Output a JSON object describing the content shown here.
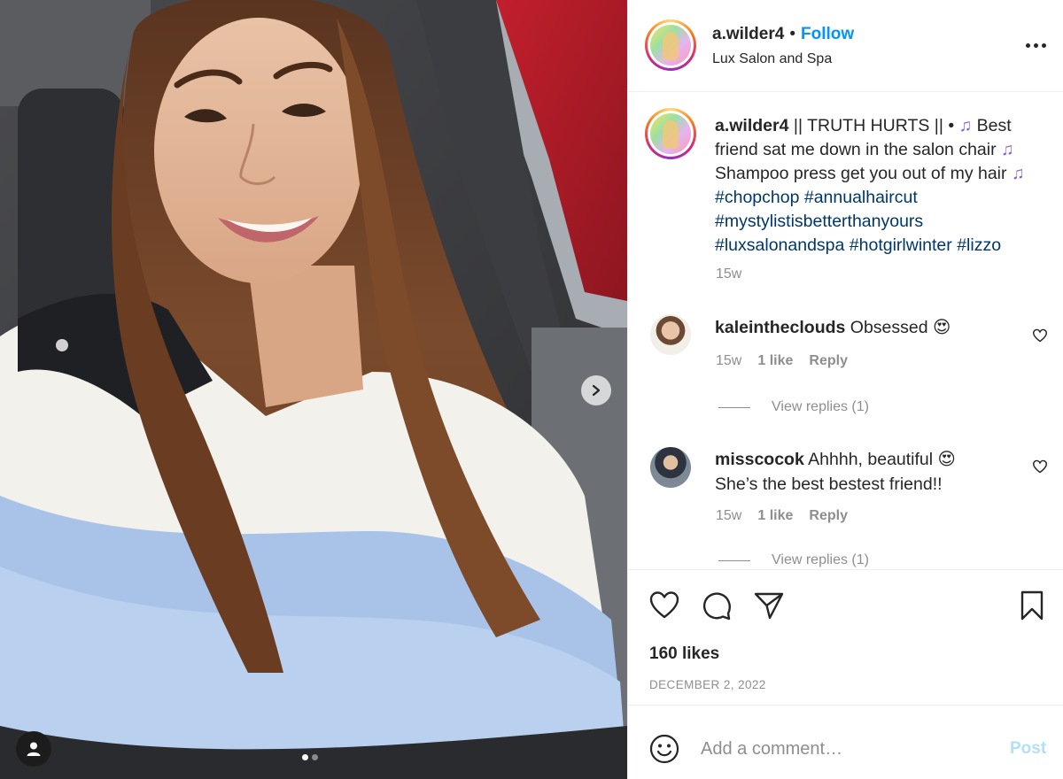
{
  "post": {
    "username": "a.wilder4",
    "separator": "•",
    "follow_label": "Follow",
    "location": "Lux Salon and Spa",
    "caption": {
      "username": "a.wilder4",
      "text_1": " || TRUTH HURTS || • ",
      "text_2": " Best friend sat me down in the salon chair ",
      "text_3": " Shampoo press get you out of my hair ",
      "hashtags": [
        "#chopchop",
        "#annualhaircut",
        "#mystylistisbetterthanyours",
        "#luxsalonandspa",
        "#hotgirlwinter",
        "#lizzo"
      ],
      "time": "15w"
    },
    "comments": [
      {
        "username": "kaleintheclouds",
        "text": "Obsessed",
        "time": "15w",
        "likes": "1 like",
        "reply_label": "Reply",
        "view_replies": "View replies (1)"
      },
      {
        "username": "misscocok",
        "text": "Ahhhh, beautiful",
        "text_line2": "She’s the best bestest friend!!",
        "time": "15w",
        "likes": "1 like",
        "reply_label": "Reply",
        "view_replies": "View replies (1)"
      }
    ],
    "likes_count": "160 likes",
    "date": "DECEMBER 2, 2022",
    "comment_placeholder": "Add a comment…",
    "post_button": "Post"
  },
  "media": {
    "current_slide": 1,
    "total_slides": 2
  },
  "icons": {
    "like": "heart-icon",
    "comment": "comment-bubble-icon",
    "share": "paper-plane-icon",
    "save": "bookmark-icon",
    "more": "more-options-icon",
    "next": "chevron-right-icon",
    "tag": "person-tag-icon",
    "emoji": "smiley-icon",
    "music": "music-notes-emoji",
    "heart_eyes": "heart-eyes-emoji"
  },
  "colors": {
    "accent_blue": "#0095f6",
    "hashtag": "#00376b",
    "muted_text": "#8e8e8e",
    "post_button_disabled": "#b2dffc"
  }
}
